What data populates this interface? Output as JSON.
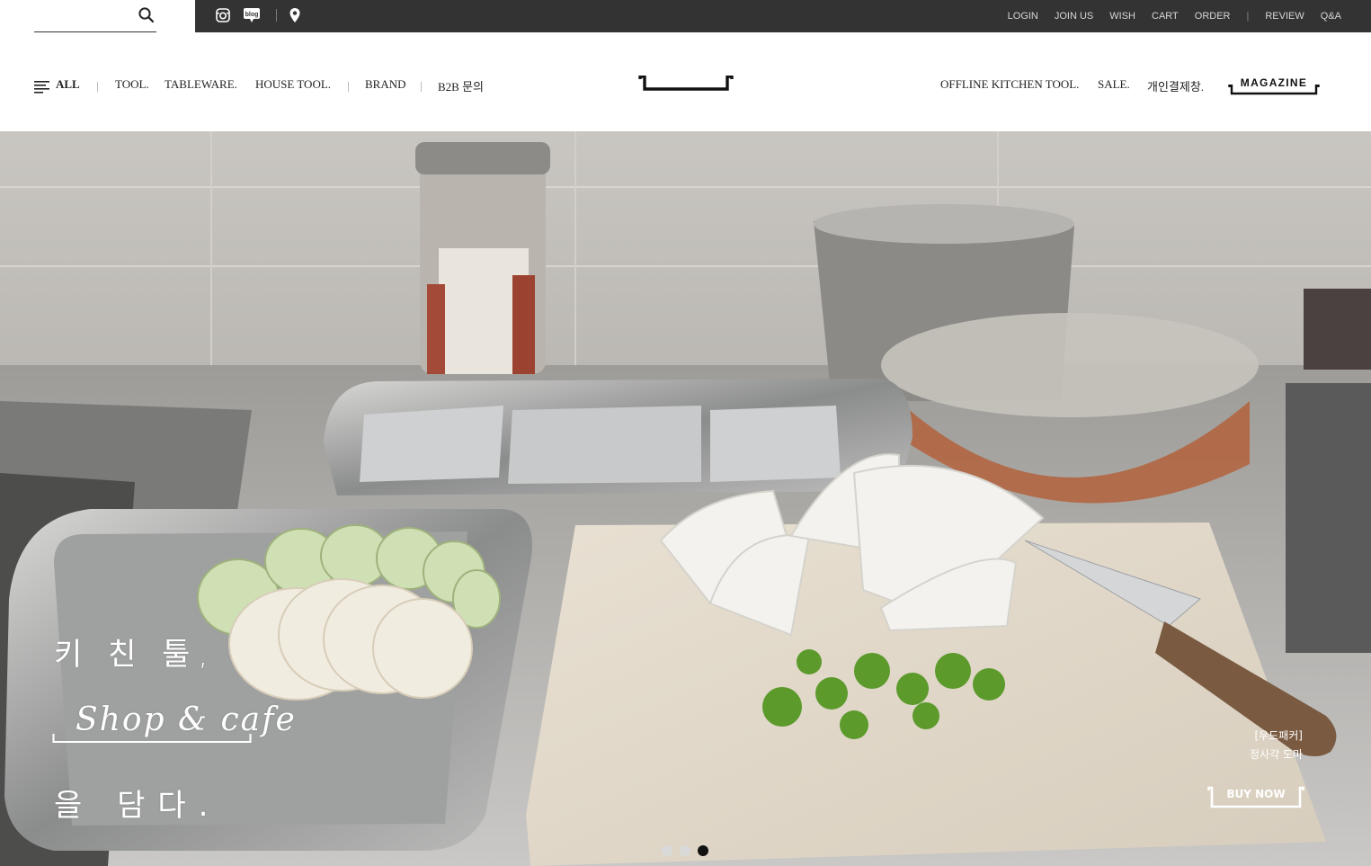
{
  "search": {
    "placeholder": ""
  },
  "utility_nav": [
    "LOGIN",
    "JOIN US",
    "WISH",
    "CART",
    "ORDER",
    "REVIEW",
    "Q&A"
  ],
  "utility_separator": "|",
  "social_icons": [
    "instagram-icon",
    "blog-icon",
    "location-pin-icon"
  ],
  "blog_icon_text": "blog",
  "main_nav": {
    "all": "ALL",
    "separator": "|",
    "left_items": [
      "TOOL.",
      "TABLEWARE.",
      "HOUSE TOOL.",
      "BRAND",
      "B2B 문의"
    ],
    "right_items": [
      "OFFLINE KITCHEN TOOL.",
      "SALE.",
      "개인결제창."
    ],
    "magazine": "MAGAZINE"
  },
  "hero": {
    "headline_1": "키 친 툴,",
    "headline_2": "Shop & cafe",
    "headline_3": "을 담다.",
    "product_brand": "[우드패커]",
    "product_name": "정사각 도마",
    "cta": "BUY NOW",
    "slides": 3,
    "active_slide": 3
  },
  "colors": {
    "topbar": "#333333",
    "utility_text": "#d6d6d6",
    "active_dot": "#111111",
    "inactive_dot": "#d9d9d9"
  }
}
